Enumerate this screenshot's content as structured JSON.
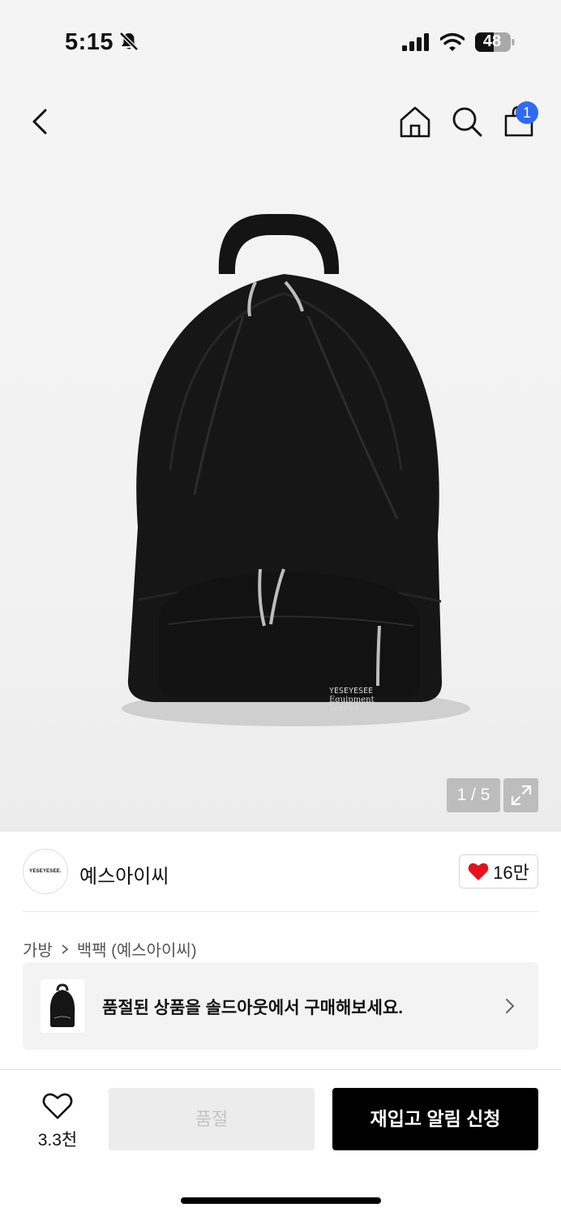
{
  "status_bar": {
    "time": "5:15",
    "battery": "48"
  },
  "header": {
    "cart_count": "1"
  },
  "gallery": {
    "pager": "1 / 5"
  },
  "brand": {
    "logo_text": "YESEYESEE.",
    "name": "예스아이씨",
    "likes": "16만"
  },
  "breadcrumb": {
    "level1": "가방",
    "level2": "백팩 (예스아이씨)"
  },
  "resell_banner": {
    "text": "품절된 상품을 솔드아웃에서 구매해보세요."
  },
  "product_print": {
    "line1": "YESEYESEE",
    "line2": "Equipment",
    "line3": "Service"
  },
  "bottom_bar": {
    "wish_count": "3.3천",
    "soldout_label": "품절",
    "restock_label": "재입고 알림 신청"
  },
  "icons": [
    "bell-off-icon",
    "signal-icon",
    "wifi-icon",
    "battery-icon",
    "back-icon",
    "home-icon",
    "search-icon",
    "cart-icon",
    "expand-icon",
    "heart-icon",
    "chevron-right-icon"
  ],
  "colors": {
    "accent": "#2f6bf0",
    "heart": "#e8101d",
    "primary_button": "#000000",
    "disabled_button": "#ececec"
  }
}
